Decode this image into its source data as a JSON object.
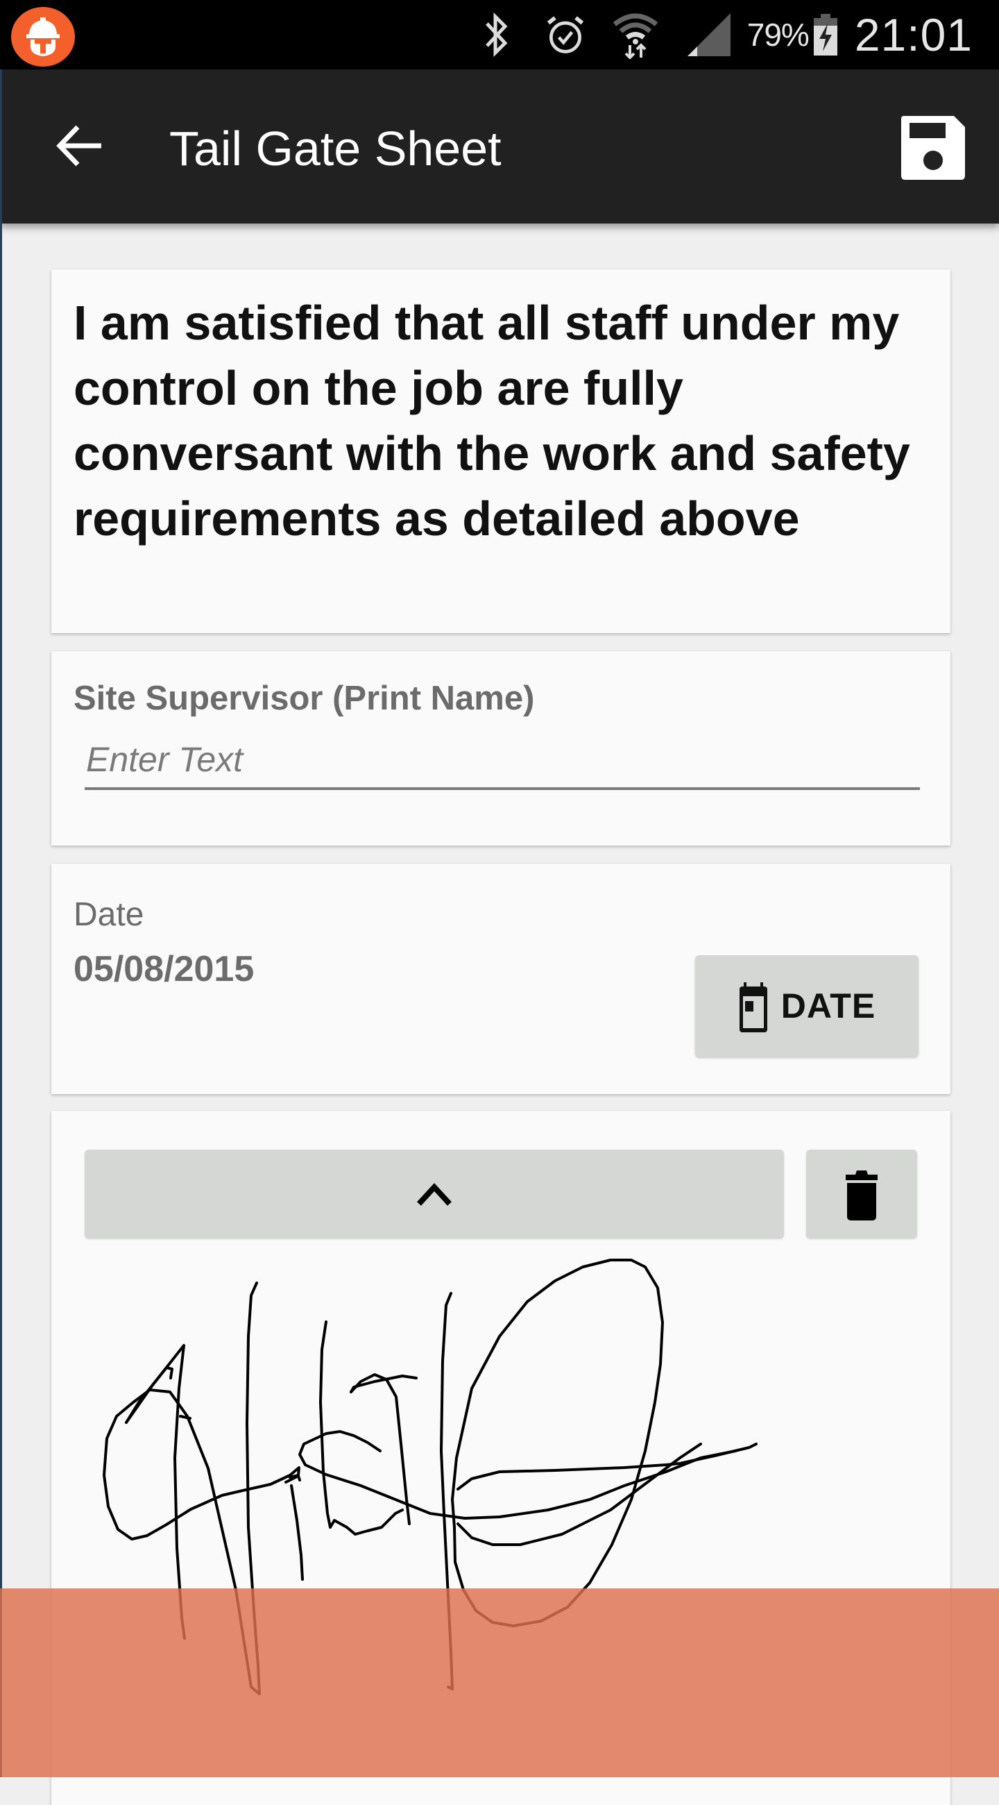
{
  "status_bar": {
    "app_icon": "hard-hat-app-icon",
    "icons": [
      "bluetooth-icon",
      "alarm-icon",
      "wifi-data-icon",
      "cell-signal-icon"
    ],
    "battery_percent": "79%",
    "battery_level": 0.79,
    "battery_charging": true,
    "time": "21:01"
  },
  "toolbar": {
    "title": "Tail Gate Sheet",
    "back_icon": "arrow-back-icon",
    "save_icon": "save-icon"
  },
  "statement": {
    "text": "I am satisfied that all staff under my control on the job are fully conversant with the work and safety requirements as detailed above"
  },
  "supervisor_field": {
    "label": "Site Supervisor (Print Name)",
    "value": "",
    "placeholder": "Enter Text"
  },
  "date_field": {
    "label": "Date",
    "value": "05/08/2015",
    "button_label": "DATE",
    "button_icon": "calendar-icon"
  },
  "signature": {
    "collapse_icon": "chevron-up-icon",
    "delete_icon": "trash-icon",
    "has_signature": true
  },
  "colors": {
    "status_bar": "#000000",
    "toolbar": "#212121",
    "background": "#efefef",
    "card": "#fafafa",
    "button": "#d5d7d4",
    "app_icon": "#f4602c",
    "overlay": "#de704e"
  }
}
